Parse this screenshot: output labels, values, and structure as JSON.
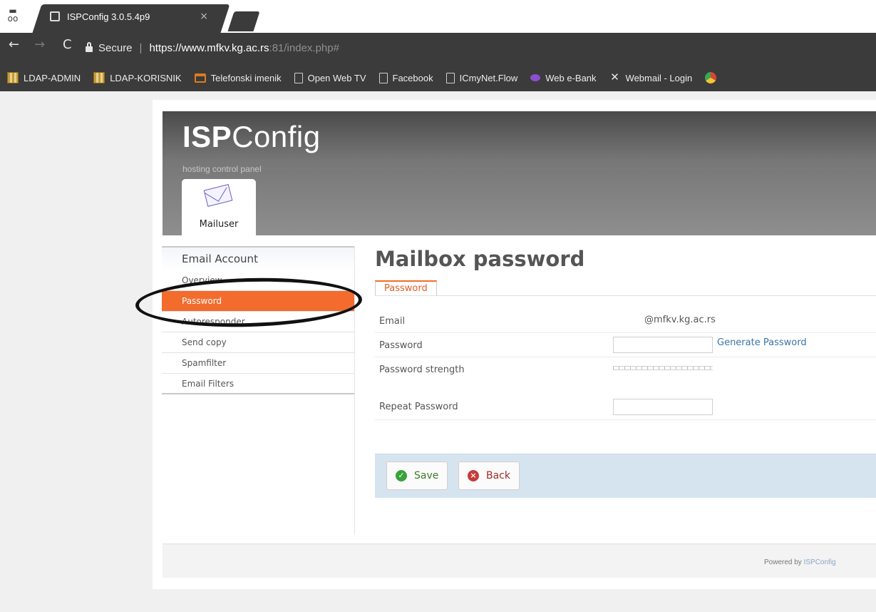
{
  "browser": {
    "tab_title": "ISPConfig 3.0.5.4p9",
    "tab_close": "×",
    "secure_label": "Secure",
    "url_main": "https://www.mfkv.kg.ac.rs",
    "url_dim": ":81/index.php#",
    "bookmarks": [
      {
        "label": "LDAP-ADMIN",
        "icon": "grid-favicon-icon"
      },
      {
        "label": "LDAP-KORISNIK",
        "icon": "grid-favicon-icon"
      },
      {
        "label": "Telefonski imenik",
        "icon": "folder-icon"
      },
      {
        "label": "Open Web TV",
        "icon": "page-icon"
      },
      {
        "label": "Facebook",
        "icon": "page-icon"
      },
      {
        "label": "ICmyNet.Flow",
        "icon": "page-icon"
      },
      {
        "label": "Web e-Bank",
        "icon": "bank-icon"
      },
      {
        "label": "Webmail - Login",
        "icon": "tools-icon"
      }
    ]
  },
  "header": {
    "logo_bold": "ISP",
    "logo_rest": "Config",
    "tagline": "hosting control panel",
    "module_tab": "Mailuser"
  },
  "sidebar": {
    "heading": "Email Account",
    "items": [
      {
        "label": "Overview",
        "active": false
      },
      {
        "label": "Password",
        "active": true
      },
      {
        "label": "Autoresponder",
        "active": false
      },
      {
        "label": "Send copy",
        "active": false
      },
      {
        "label": "Spamfilter",
        "active": false
      },
      {
        "label": "Email Filters",
        "active": false
      }
    ]
  },
  "main": {
    "title": "Mailbox password",
    "subtab": "Password",
    "email_label": "Email",
    "email_value": "@mfkv.kg.ac.rs",
    "password_label": "Password",
    "password_value": "",
    "generate_link": "Generate Password",
    "strength_label": "Password strength",
    "repeat_label": "Repeat Password",
    "repeat_value": "",
    "save_label": "Save",
    "back_label": "Back"
  },
  "footer": {
    "powered_prefix": "Powered by ",
    "powered_brand": "ISPConfig"
  },
  "colors": {
    "accent": "#f36c2d",
    "link": "#3a74a8",
    "button_bar": "#d6e4f0"
  }
}
